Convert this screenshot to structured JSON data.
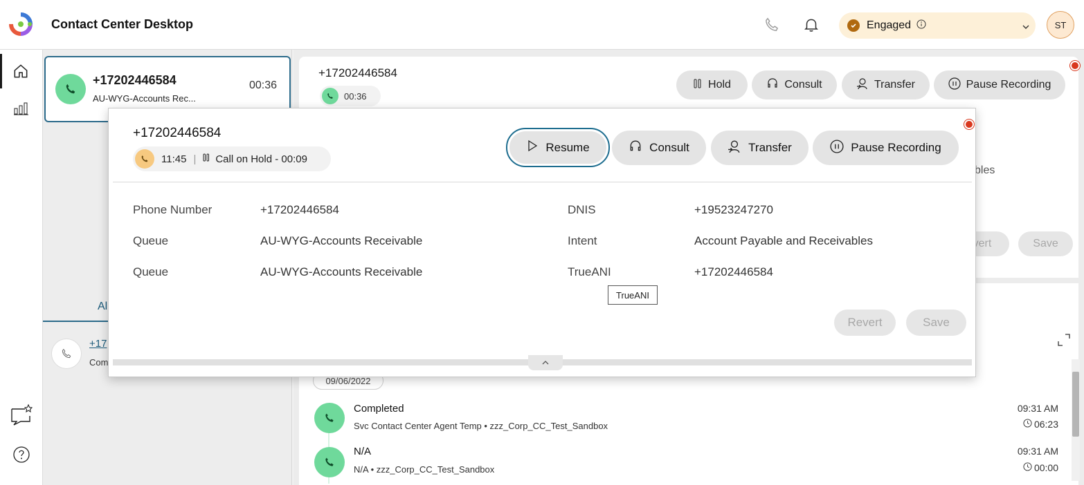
{
  "header": {
    "app_title": "Contact Center Desktop",
    "status": "Engaged",
    "avatar_initials": "ST",
    "brand_colors": [
      "#3d7ad6",
      "#e8593c",
      "#7ac943",
      "#9b5de5"
    ]
  },
  "task": {
    "ani": "+17202446584",
    "queue": "AU-WYG-Accounts Rec...",
    "timer": "00:36"
  },
  "tasklist": {
    "tab_label": "Al",
    "history_ani": "+17",
    "history_sub": "Com"
  },
  "callbar": {
    "ani": "+17202446584",
    "timer": "00:36",
    "hold_label": "Hold",
    "consult_label": "Consult",
    "transfer_label": "Transfer",
    "pause_label": "Pause Recording"
  },
  "cad_background": {
    "partial_text": "bles",
    "revert_label": "vert",
    "save_label": "Save"
  },
  "popover": {
    "ani": "+17202446584",
    "timer": "11:45",
    "hold_status": "Call on Hold - 00:09",
    "resume_label": "Resume",
    "consult_label": "Consult",
    "transfer_label": "Transfer",
    "pause_label": "Pause Recording",
    "fields_left": [
      {
        "label": "Phone Number",
        "value": "+17202446584"
      },
      {
        "label": "Queue",
        "value": "AU-WYG-Accounts Receivable"
      },
      {
        "label": "Queue",
        "value": "AU-WYG-Accounts Receivable"
      }
    ],
    "fields_right": [
      {
        "label": "DNIS",
        "value": "+19523247270"
      },
      {
        "label": "Intent",
        "value": "Account Payable and Receivables"
      },
      {
        "label": "TrueANI",
        "value": "+17202446584"
      }
    ],
    "tooltip": "TrueANI",
    "revert_label": "Revert",
    "save_label": "Save"
  },
  "history": {
    "date": "09/06/2022",
    "items": [
      {
        "title": "Completed",
        "detail": "Svc Contact Center Agent Temp • zzz_Corp_CC_Test_Sandbox",
        "time": "09:31 AM",
        "duration": "06:23"
      },
      {
        "title": "N/A",
        "detail": "N/A • zzz_Corp_CC_Test_Sandbox",
        "time": "09:31 AM",
        "duration": "00:00"
      }
    ]
  },
  "icons": {
    "phone": "phone-icon",
    "bell": "bell-icon",
    "home": "home-icon",
    "chart": "chart-icon",
    "chat": "chat-icon",
    "help": "help-icon"
  }
}
